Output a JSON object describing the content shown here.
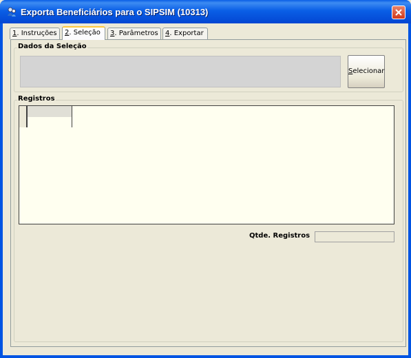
{
  "window": {
    "title": "Exporta Beneficiários para o SIPSIM (10313)",
    "icon": "app-icon",
    "close_icon": "close-icon"
  },
  "tabs": [
    {
      "mnemonic": "1",
      "label": ". Instruções",
      "active": false
    },
    {
      "mnemonic": "2",
      "label": ". Seleção",
      "active": true
    },
    {
      "mnemonic": "3",
      "label": ". Parâmetros",
      "active": false
    },
    {
      "mnemonic": "4",
      "label": ". Exportar",
      "active": false
    }
  ],
  "selection": {
    "group_title": "Dados da Seleção",
    "field_value": "",
    "button_mnemonic": "S",
    "button_rest": "elecionar"
  },
  "records": {
    "group_title": "Registros",
    "count_label": "Qtde. Registros",
    "count_value": ""
  },
  "colors": {
    "titlebar": "#0a5fe6",
    "grid_background": "#fffff0",
    "face": "#ece9d8"
  }
}
